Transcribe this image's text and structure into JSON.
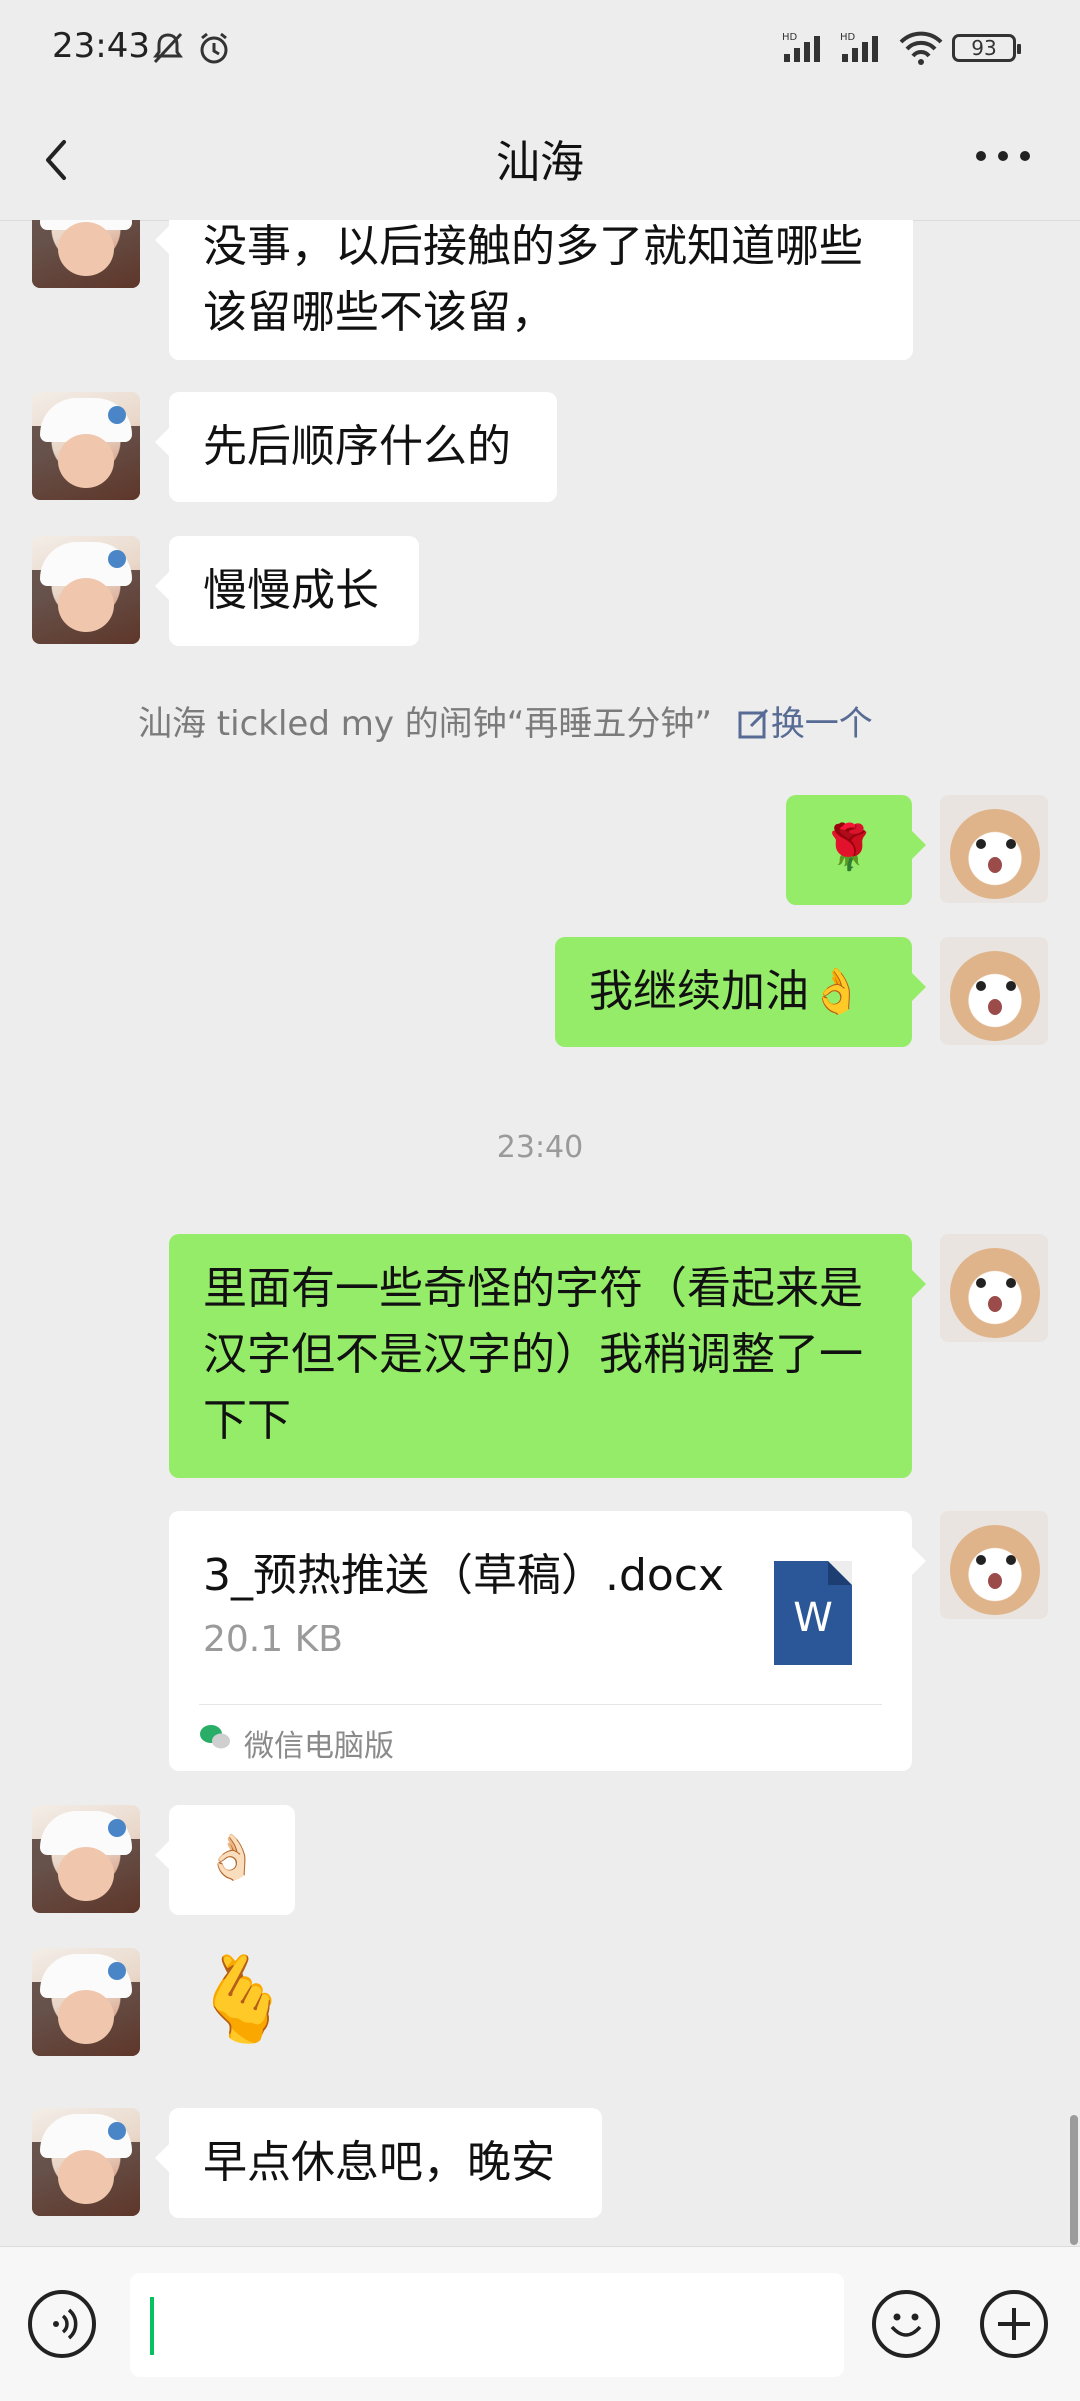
{
  "status_bar": {
    "time": "23:43",
    "battery": "93",
    "icons": [
      "mute-bell-icon",
      "alarm-icon",
      "hd-signal-icon",
      "hd-signal-icon",
      "wifi-icon",
      "battery-icon"
    ]
  },
  "header": {
    "title": "汕海",
    "back_icon": "chevron-left-icon",
    "more_icon": "more-dots-icon"
  },
  "messages": {
    "m1": "没事，以后接触的多了就知道哪些该留哪些不该留，",
    "m2": "先后顺序什么的",
    "m3": "慢慢成长",
    "tickle": {
      "text": "汕海 tickled my  的闹钟“再睡五分钟”",
      "action": "换一个"
    },
    "m4_emoji": "🌹",
    "m5": "我继续加油👌",
    "timestamp": "23:40",
    "m6": "里面有一些奇怪的字符（看起来是汉字但不是汉字的）我稍调整了一下下",
    "file": {
      "name": "3_预热推送（草稿）.docx",
      "size": "20.1 KB",
      "source": "微信电脑版",
      "type_letter": "W"
    },
    "m7_emoji": "👌🏻",
    "m8_emoji": "🫰",
    "m9": "早点休息吧，晚安"
  },
  "colors": {
    "sent_bubble": "#95ec69",
    "received_bubble": "#ffffff",
    "background": "#ededed",
    "link": "#576b95",
    "caret": "#07c160"
  }
}
